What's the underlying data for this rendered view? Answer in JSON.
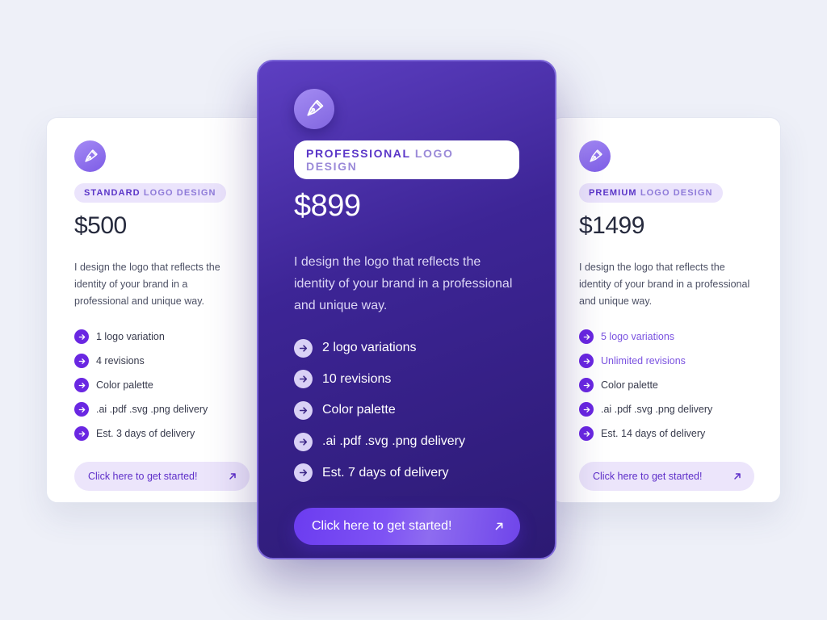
{
  "cards": [
    {
      "badge_part1": "STANDARD",
      "badge_part2": "LOGO DESIGN",
      "price": "$500",
      "description": "I design the logo that reflects the identity of your brand in a professional and unique way.",
      "features": [
        "1 logo variation",
        "4 revisions",
        "Color palette",
        ".ai .pdf .svg .png delivery",
        "Est. 3 days of delivery"
      ],
      "cta_label": "Click here to get started!",
      "icon": "pen-nib-icon"
    },
    {
      "badge_part1": "PROFESSIONAL",
      "badge_part2": "LOGO DESIGN",
      "price": "$899",
      "description": "I design the logo that reflects the identity of your brand in a professional and unique way.",
      "features": [
        "2 logo variations",
        "10 revisions",
        "Color palette",
        ".ai .pdf .svg .png delivery",
        "Est. 7 days of delivery"
      ],
      "cta_label": "Click here to get started!",
      "icon": "pen-nib-icon"
    },
    {
      "badge_part1": "PREMIUM",
      "badge_part2": "LOGO DESIGN",
      "price": "$1499",
      "description": "I design the logo that reflects the identity of your brand in a professional and unique way.",
      "features": [
        "5 logo variations",
        "Unlimited revisions",
        "Color palette",
        ".ai .pdf .svg .png delivery",
        "Est. 14 days of delivery"
      ],
      "cta_label": "Click here to get started!",
      "icon": "pen-nib-icon"
    }
  ],
  "colors": {
    "accent": "#6a27e2",
    "featured_bg": "#3d2596",
    "page_bg": "#eef0f8"
  }
}
